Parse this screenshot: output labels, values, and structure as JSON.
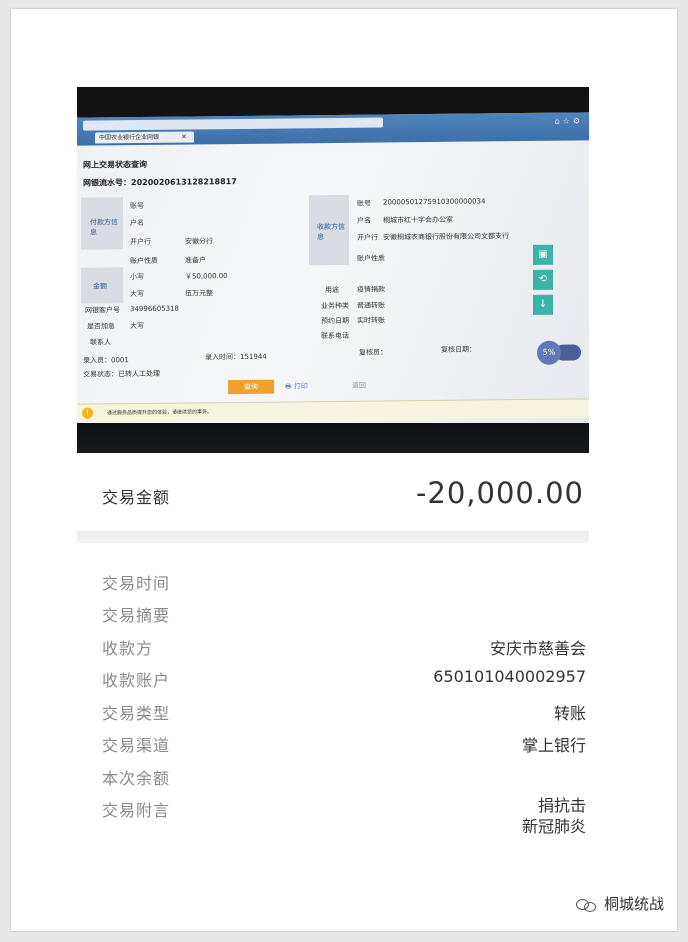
{
  "summary": {
    "amount_label": "交易金额",
    "amount_value": "-20,000.00"
  },
  "details": [
    {
      "label": "交易时间",
      "value": ""
    },
    {
      "label": "交易摘要",
      "value": ""
    },
    {
      "label": "收款方",
      "value": "安庆市慈善会"
    },
    {
      "label": "收款账户",
      "value": "650101040002957"
    },
    {
      "label": "交易类型",
      "value": "转账"
    },
    {
      "label": "交易渠道",
      "value": "掌上银行"
    },
    {
      "label": "本次余额",
      "value": ""
    },
    {
      "label": "交易附言",
      "value_lines": [
        "捐抗击",
        "新冠肺炎"
      ]
    }
  ],
  "footer": {
    "source": "桐城统战",
    "icon": "wechat-icon"
  },
  "photo": {
    "tab_title": "中国农业银行企业网银",
    "page_title": "网上交易状态查询",
    "serial_label": "网银流水号：",
    "serial_value": "2020020613128218817",
    "payer_header": "付款方信息",
    "payee_header": "收款方信息",
    "account_no_label": "账号",
    "name_label": "户名",
    "bank_label": "开户行",
    "account_type_label": "账户性质",
    "payer_bank": "安徽分行",
    "payer_account_type": "准备户",
    "payee_account": "20000501275910300000034",
    "payee_name": "桐城市红十字会办公室",
    "payee_bank": "安徽桐城农商银行股份有限公司文都支行",
    "amount_header": "金额",
    "small_label": "小写",
    "small_value": "￥50,000.00",
    "big_label": "大写",
    "big_value": "伍万元整",
    "purpose_label": "用途",
    "purpose_value": "疫情捐款",
    "business_type_label": "业务种类",
    "business_type_value": "普通转账",
    "date_label": "预约日期",
    "date_value": "实时转账",
    "contact_label": "联系电话",
    "cust_no_label": "网银客户号",
    "cust_no_value": "34996605318",
    "urgent_label": "是否加急",
    "contact_person_label": "联系人",
    "operator_label": "录入员：0001",
    "entry_time_label": "录入时间：151944",
    "reviewer_label": "复核员：",
    "review_date_label": "复核日期：",
    "status_label": "交易状态：已转人工处理",
    "query_button": "查询",
    "print_button": "打印",
    "back_button": "返回",
    "notice_text": "通过服务品质提升您的体验，请继续您的事务。",
    "speed_text": "5%"
  },
  "colors": {
    "accent": "#3bb3a6",
    "query_button": "#f2a02d",
    "label_gray": "#8a8a8a"
  }
}
